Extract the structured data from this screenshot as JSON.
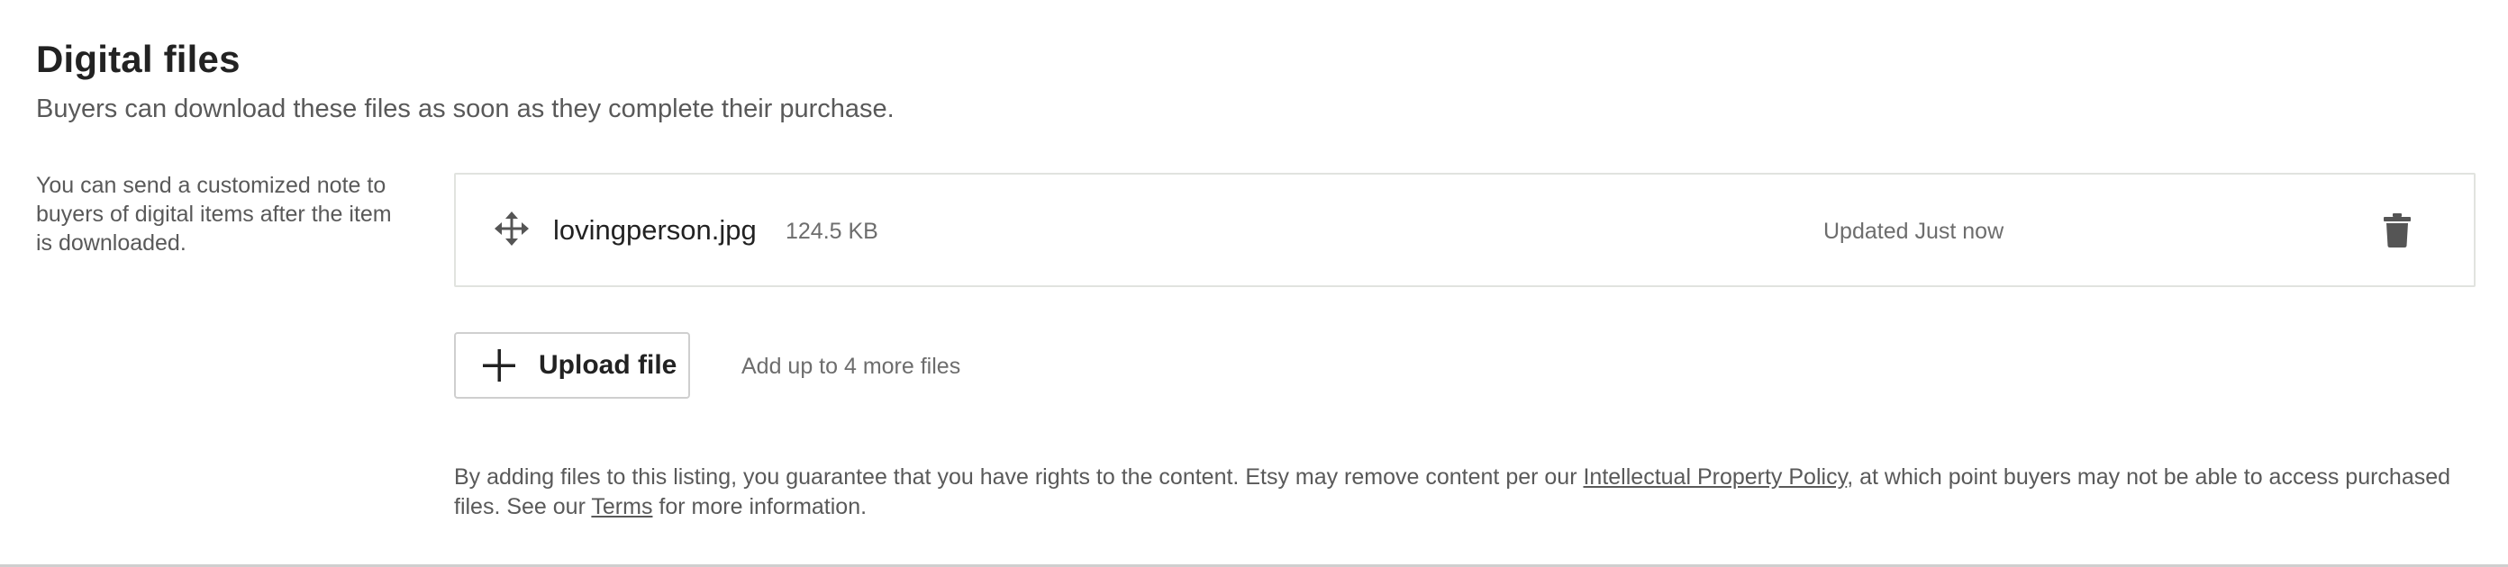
{
  "section": {
    "title": "Digital files",
    "subtitle": "Buyers can download these files as soon as they complete their purchase."
  },
  "side_note": "You can send a customized note to buyers of digital items after the item is downloaded.",
  "files": [
    {
      "name": "lovingperson.jpg",
      "size": "124.5 KB",
      "updated": "Updated Just now",
      "drag_icon": "move-icon",
      "delete_icon": "trash-icon"
    }
  ],
  "upload": {
    "label": "Upload file",
    "icon": "plus-icon",
    "hint": "Add up to 4 more files"
  },
  "disclaimer": {
    "part1": "By adding files to this listing, you guarantee that you have rights to the content. Etsy may remove content per our ",
    "ip_link": "Intellectual Property Policy",
    "part2": ", at which point buyers may not be able to access purchased files. See our ",
    "terms_link": "Terms",
    "part3": " for more information."
  },
  "colors": {
    "text_primary": "#222222",
    "text_secondary": "#595959",
    "text_muted": "#6d6d6d",
    "border": "#e1e3df",
    "icon": "#555555"
  }
}
